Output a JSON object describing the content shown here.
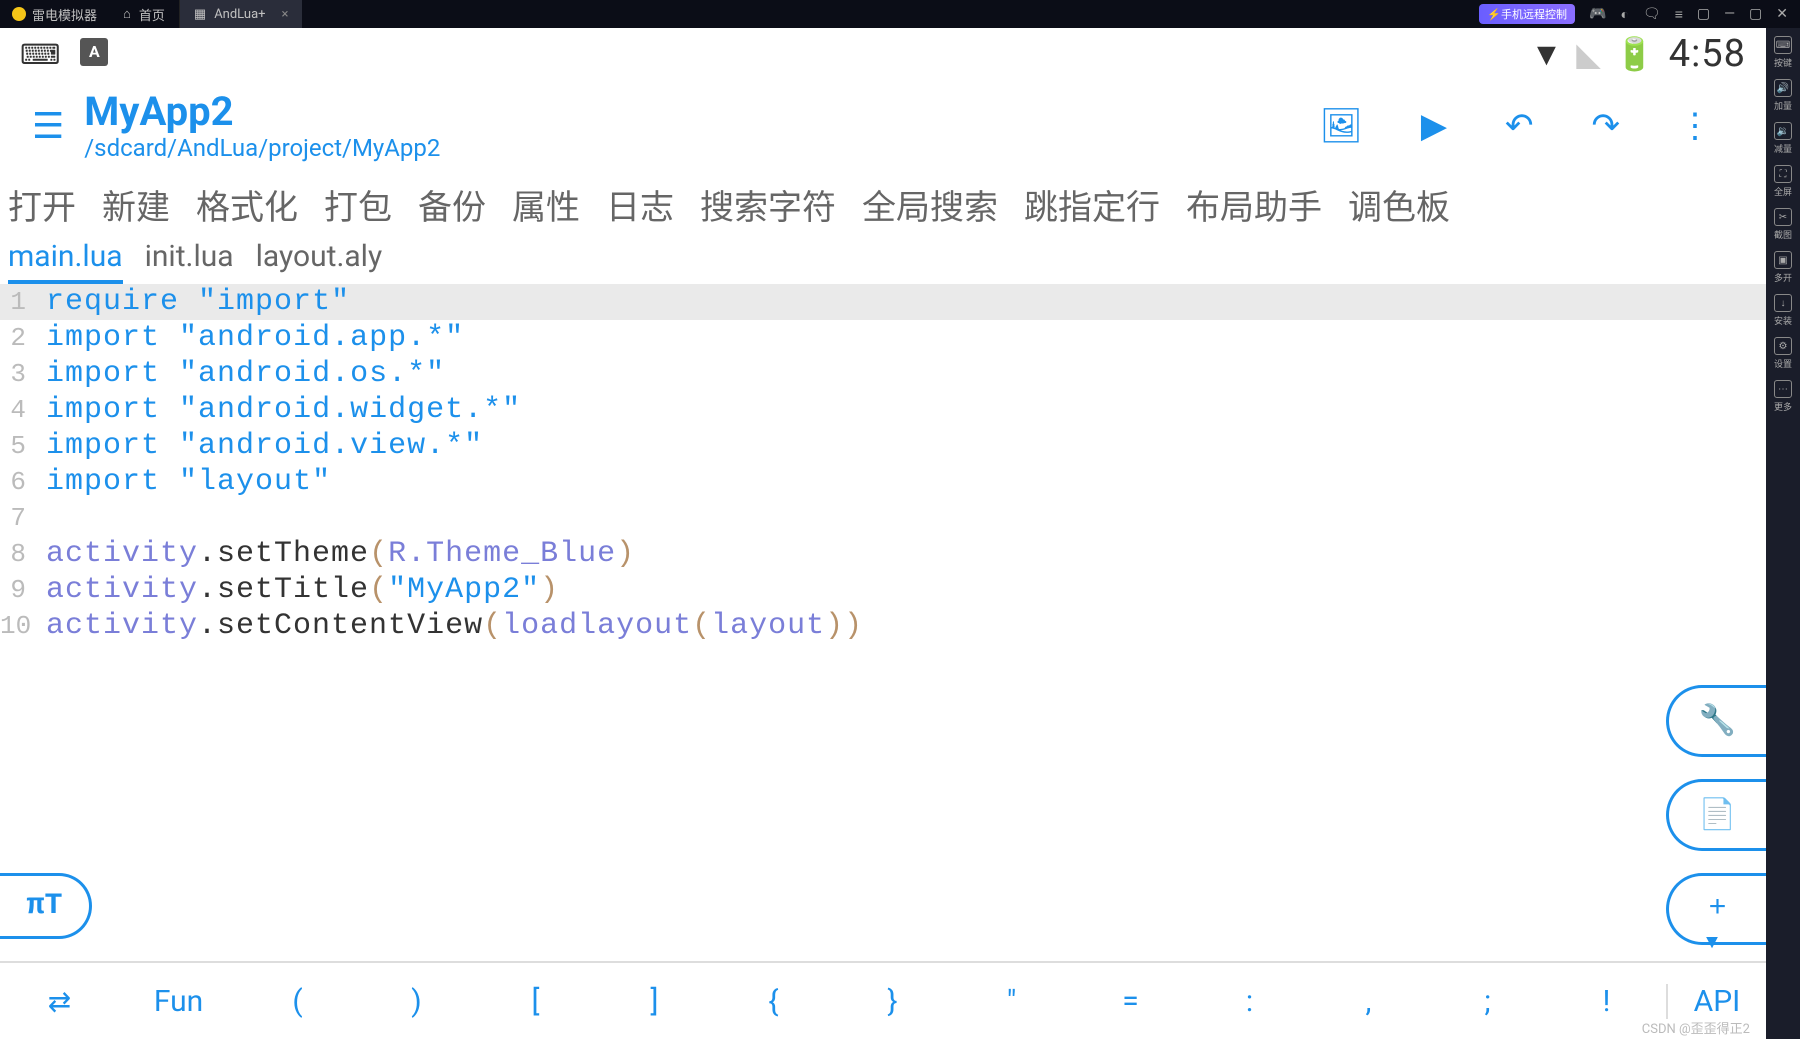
{
  "emu": {
    "name": "雷电模拟器",
    "tabs": {
      "home": "首页",
      "active": "AndLua+"
    },
    "remote": "手机远程控制",
    "sidebar": [
      {
        "icon": "⌨",
        "label": "按键"
      },
      {
        "icon": "🔊",
        "label": "加量"
      },
      {
        "icon": "🔉",
        "label": "减量"
      },
      {
        "icon": "⛶",
        "label": "全屏"
      },
      {
        "icon": "✂",
        "label": "截图"
      },
      {
        "icon": "▣",
        "label": "多开"
      },
      {
        "icon": "↓",
        "label": "安装"
      },
      {
        "icon": "⚙",
        "label": "设置"
      },
      {
        "icon": "⋯",
        "label": "更多"
      }
    ]
  },
  "status": {
    "time": "4:58",
    "lang": "A"
  },
  "header": {
    "title": "MyApp2",
    "path": "/sdcard/AndLua/project/MyApp2"
  },
  "toolbar": [
    "打开",
    "新建",
    "格式化",
    "打包",
    "备份",
    "属性",
    "日志",
    "搜索字符",
    "全局搜索",
    "跳指定行",
    "布局助手",
    "调色板"
  ],
  "files": [
    {
      "name": "main.lua",
      "active": true
    },
    {
      "name": "init.lua",
      "active": false
    },
    {
      "name": "layout.aly",
      "active": false
    }
  ],
  "code": [
    {
      "n": 1,
      "hl": true,
      "tokens": [
        [
          "kw",
          "require"
        ],
        [
          "",
          " "
        ],
        [
          "str",
          "\"import\""
        ]
      ]
    },
    {
      "n": 2,
      "tokens": [
        [
          "kw",
          "import"
        ],
        [
          "",
          " "
        ],
        [
          "str",
          "\"android.app.*\""
        ]
      ]
    },
    {
      "n": 3,
      "tokens": [
        [
          "kw",
          "import"
        ],
        [
          "",
          " "
        ],
        [
          "str",
          "\"android.os.*\""
        ]
      ]
    },
    {
      "n": 4,
      "tokens": [
        [
          "kw",
          "import"
        ],
        [
          "",
          " "
        ],
        [
          "str",
          "\"android.widget.*\""
        ]
      ]
    },
    {
      "n": 5,
      "tokens": [
        [
          "kw",
          "import"
        ],
        [
          "",
          " "
        ],
        [
          "str",
          "\"android.view.*\""
        ]
      ]
    },
    {
      "n": 6,
      "tokens": [
        [
          "kw",
          "import"
        ],
        [
          "",
          " "
        ],
        [
          "str",
          "\"layout\""
        ]
      ]
    },
    {
      "n": 7,
      "tokens": []
    },
    {
      "n": 8,
      "tokens": [
        [
          "ident",
          "activity"
        ],
        [
          "method",
          ".setTheme"
        ],
        [
          "paren",
          "("
        ],
        [
          "ident",
          "R.Theme_Blue"
        ],
        [
          "paren",
          ")"
        ]
      ]
    },
    {
      "n": 9,
      "tokens": [
        [
          "ident",
          "activity"
        ],
        [
          "method",
          ".setTitle"
        ],
        [
          "paren",
          "("
        ],
        [
          "str",
          "\"MyApp2\""
        ],
        [
          "paren",
          ")"
        ]
      ]
    },
    {
      "n": 10,
      "tokens": [
        [
          "ident",
          "activity"
        ],
        [
          "method",
          ".setContentView"
        ],
        [
          "paren",
          "("
        ],
        [
          "ident",
          "loadlayout"
        ],
        [
          "paren",
          "("
        ],
        [
          "ident",
          "layout"
        ],
        [
          "paren",
          "))"
        ]
      ]
    }
  ],
  "symbols": [
    "⇄",
    "Fun",
    "(",
    ")",
    "[",
    "]",
    "{",
    "}",
    "\"",
    "=",
    ":",
    ",",
    ";",
    "!",
    "API"
  ],
  "fab_left": "πT",
  "watermark": "CSDN @歪歪得正2"
}
